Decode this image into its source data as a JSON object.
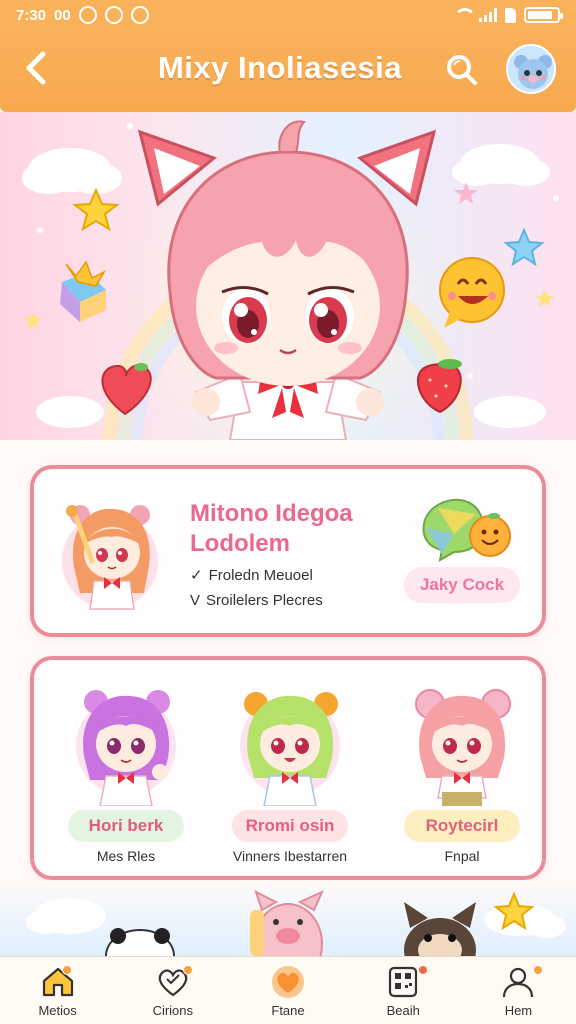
{
  "status_bar": {
    "time": "7:30",
    "status_number": "00",
    "battery_level": 0.85
  },
  "app_bar": {
    "title": "Mixy Inoliasesia"
  },
  "feature_card": {
    "title_line1": "Mitono Idegoa",
    "title_line2": "Lodolem",
    "items": [
      {
        "mark": "✓",
        "text": "Froledn Meuoel"
      },
      {
        "mark": "V",
        "text": "Sroilelers Plecres"
      }
    ],
    "badge": "Jaky Cock"
  },
  "characters": [
    {
      "badge": "Hori berk",
      "subtitle": "Mes Rles",
      "badge_bg": "#e3f4e2",
      "badge_color": "#e25c7b"
    },
    {
      "badge": "Rromi osin",
      "subtitle": "Vinners Ibestarren",
      "badge_bg": "#fde3e6",
      "badge_color": "#e6607e"
    },
    {
      "badge": "Roytecirl",
      "subtitle": "Fnpal",
      "badge_bg": "#fdeec0",
      "badge_color": "#e0607c"
    }
  ],
  "bottom_nav": [
    {
      "label": "Metios",
      "icon": "home-icon",
      "badge": true
    },
    {
      "label": "Cirions",
      "icon": "heart-outline-icon",
      "badge": true
    },
    {
      "label": "Ftane",
      "icon": "heart-filled-icon",
      "badge": false
    },
    {
      "label": "Beaih",
      "icon": "qr-scan-icon",
      "badge": true
    },
    {
      "label": "Hem",
      "icon": "profile-icon",
      "badge": true
    }
  ],
  "colors": {
    "accent": "#f9b15a",
    "card_border": "#ec8c98",
    "title_pink": "#e96a8c"
  }
}
